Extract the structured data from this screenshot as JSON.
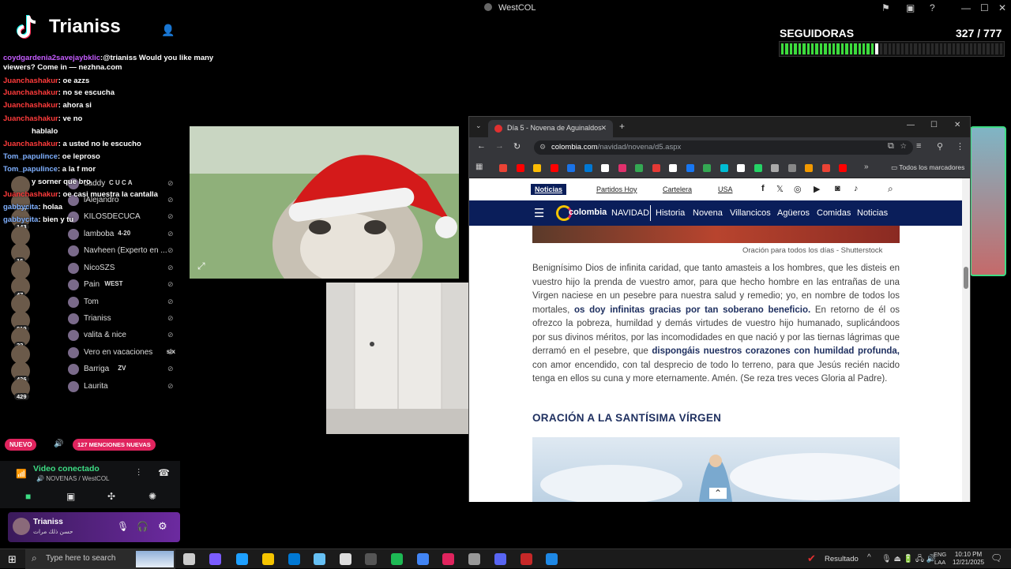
{
  "window": {
    "title": "WestCOL"
  },
  "tiktok": {
    "username": "Trianiss"
  },
  "chat": [
    {
      "user": "coydgardenia2savejaybklic",
      "text": ":@trianiss Would you like many"
    },
    {
      "user": "",
      "text": "viewers? Come in — nezhna.com"
    },
    {
      "user": "Juanchashakur",
      "text": "oe azzs"
    },
    {
      "user": "Juanchashakur",
      "text": "no se escucha"
    },
    {
      "user": "Juanchashakur",
      "text": "ahora si"
    },
    {
      "user": "Juanchashakur",
      "text": "ve no"
    },
    {
      "user": "",
      "text": "hablalo"
    },
    {
      "user": "Juanchashakur",
      "text": "a usted no le escucho"
    },
    {
      "user": "Tom_papulince",
      "text": "oe leproso"
    },
    {
      "user": "Tom_papulince",
      "text": "a la f mor"
    },
    {
      "user": "",
      "text": "y sorner que bro"
    },
    {
      "user": "Juanchashakur",
      "text": "oe casi muestra la cantalla"
    },
    {
      "user": "gabbycita",
      "text": "holaa"
    },
    {
      "user": "gabbycita",
      "text": "bien y tu"
    }
  ],
  "discord": {
    "members": [
      {
        "name": "daddy",
        "tag": "C U C A",
        "count": ""
      },
      {
        "name": "lAlejandro",
        "tag": "",
        "count": "127"
      },
      {
        "name": "KILOSDECUCA",
        "tag": "",
        "count": "143"
      },
      {
        "name": "lamboba",
        "tag": "4-20",
        "count": ""
      },
      {
        "name": "Navheen (Experto en ...",
        "tag": "",
        "count": "16"
      },
      {
        "name": "NicoSZS",
        "tag": "",
        "count": ""
      },
      {
        "name": "Pain",
        "tag": "WEST",
        "count": "47"
      },
      {
        "name": "Tom",
        "tag": "",
        "count": ""
      },
      {
        "name": "Trianiss",
        "tag": "",
        "count": "819"
      },
      {
        "name": "valita & nice",
        "tag": "",
        "count": "22"
      },
      {
        "name": "Vero en vacaciones",
        "tag": "six",
        "count": ""
      },
      {
        "name": "Barriga",
        "tag": "ZV",
        "count": "436"
      },
      {
        "name": "Laurita",
        "tag": "",
        "count": "429"
      }
    ],
    "nuevo": "NUEVO",
    "menciones": "127 MENCIONES NUEVAS",
    "voice_status": "Video conectado",
    "voice_channel": "NOVENAS / WestCOL",
    "user_name": "Trianiss",
    "user_status": "حسن ذلك مرات"
  },
  "followers": {
    "label": "SEGUIDORAS",
    "count": "327 / 777",
    "progress": 0.42
  },
  "browser": {
    "tab_title": "Día 5 - Novena de Aguinaldos",
    "url_domain": "colombia.com",
    "url_path": "/navidad/novena/d5.aspx",
    "bookmarks_all": "Todos los marcadores",
    "topnav": [
      "Noticias",
      "Partidos Hoy",
      "Cartelera",
      "USA"
    ],
    "logo": "colombia",
    "mainnav": [
      "NAVIDAD",
      "Historia",
      "Novena",
      "Villancicos",
      "Agüeros",
      "Comidas",
      "Noticias"
    ],
    "caption": "Oración para todos los días - Shutterstock",
    "paragraph_1": "Benignísimo Dios de infinita caridad, que tanto amasteis a los hombres, que les disteis en vuestro hijo la prenda de vuestro amor, para que hecho hombre en las entrañas de una Virgen naciese en un pesebre para nuestra salud y remedio; yo, en nombre de todos los mortales, ",
    "bold_1": "os doy infinitas gracias por tan soberano beneficio.",
    "paragraph_2": " En retorno de él os ofrezco la pobreza, humildad y demás virtudes de vuestro hijo humanado, suplicándoos por sus divinos méritos, por las incomodidades en que nació y por las tiernas lágrimas que derramó en el pesebre, que ",
    "bold_2": "dispongáis nuestros corazones con humildad profunda,",
    "paragraph_3": " con amor encendido, con tal desprecio de todo lo terreno, para que Jesús recién nacido tenga en ellos su cuna y more eternamente. Amén. (Se reza tres veces Gloria al Padre).",
    "section_title": "ORACIÓN A LA SANTÍSIMA VÍRGEN"
  },
  "taskbar": {
    "search_placeholder": "Type here to search",
    "resultado": "Resultado",
    "lang": "ENG",
    "region": "LAA",
    "time": "10:10 PM",
    "date": "12/21/2025"
  },
  "colors": {
    "discord_purple": "#6c2aa0",
    "news_blue": "#0a1e5a",
    "progress_green": "#3ddc3d",
    "mention_red": "#e0245e"
  }
}
